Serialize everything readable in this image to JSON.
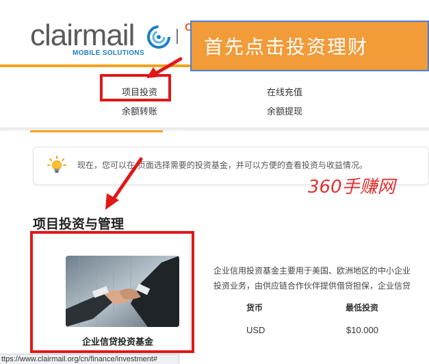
{
  "logo": {
    "wordmark": "clairmail",
    "tagline": "MOBILE SOLUTIONS",
    "partial_tab": "CM"
  },
  "callout": {
    "text": "首先点击投资理财"
  },
  "nav": {
    "items": [
      {
        "label": "项目投资"
      },
      {
        "label": "在线充值"
      },
      {
        "label": "余额转账"
      },
      {
        "label": "余额提现"
      }
    ]
  },
  "tip": {
    "icon": "lightbulb-icon",
    "text": "现在，您可以在  页面选择需要的投资基金，并可以方便的查看投资与收益情况。"
  },
  "watermark": {
    "text": "360手赚网"
  },
  "section": {
    "title": "项目投资与管理",
    "fund": {
      "image": "handshake-photo",
      "caption": "企业信贷投资基金",
      "description": [
        "企业信用投资基金主要用于美国、欧洲地区的中小企业",
        "投资业务，由供应链合作伙伴提供借贷担保，企业信贷"
      ],
      "table": {
        "headers": [
          "货币",
          "最低投资"
        ],
        "row": [
          "USD",
          "$10.000"
        ]
      }
    }
  },
  "statusbar": {
    "url": "ttps://www.clairmail.org/cn/finance/investment#"
  },
  "colors": {
    "accent": "#f5a21b",
    "callout_bg": "#f19b39",
    "annotation_red": "#e01818",
    "brand_blue": "#1a7fc1"
  }
}
